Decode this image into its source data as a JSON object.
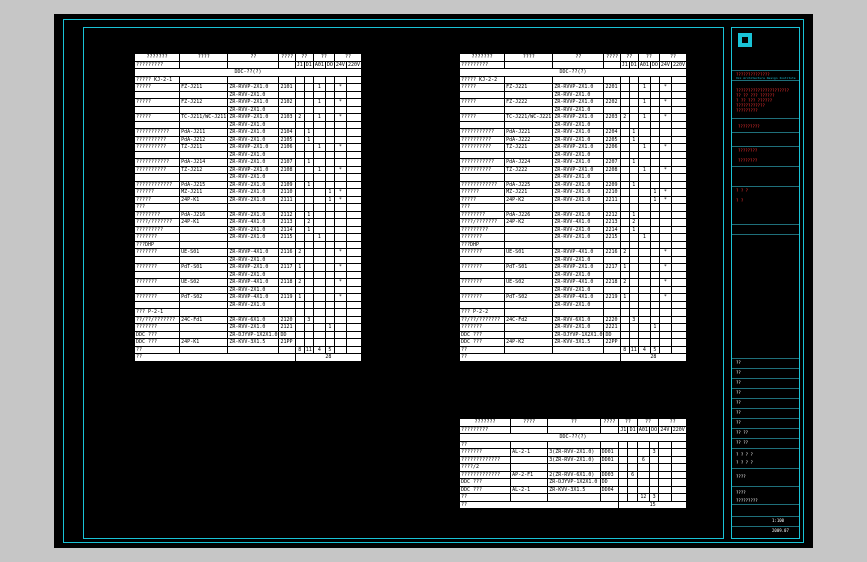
{
  "left_table": {
    "header": [
      "???????",
      "????",
      "??",
      "????",
      "??",
      "??",
      "??"
    ],
    "header2": [
      "?????????",
      "",
      "",
      "",
      "J1",
      "D1",
      "A01",
      "DO",
      "24V",
      "220V"
    ],
    "section": "DDC-??(?)",
    "rows": [
      [
        "????? KJ-2-1",
        "",
        "",
        "",
        "",
        "",
        "",
        "",
        "",
        ""
      ],
      [
        "?????",
        "FZ-J211",
        "ZR-RVVP-2X1.0",
        "2101",
        "",
        "",
        "1",
        "",
        "*",
        ""
      ],
      [
        "",
        "",
        "ZR-RVV-2X1.0",
        "",
        "",
        "",
        "",
        "",
        "",
        ""
      ],
      [
        "?????",
        "FZ-J212",
        "ZR-RVVP-2X1.0",
        "2102",
        "",
        "",
        "1",
        "",
        "*",
        ""
      ],
      [
        "",
        "",
        "ZR-RVV-2X1.0",
        "",
        "",
        "",
        "",
        "",
        "",
        ""
      ],
      [
        "?????",
        "TC-J211/WC-J211",
        "ZR-RVVP-2X1.0",
        "2103",
        "2",
        "",
        "1",
        "",
        "*",
        ""
      ],
      [
        "",
        "",
        "ZR-RVV-2X1.0",
        "",
        "",
        "",
        "",
        "",
        "",
        ""
      ],
      [
        "???????????",
        "PdA-J211",
        "ZR-RVV-2X1.0",
        "2104",
        "",
        "1",
        "",
        "",
        "",
        ""
      ],
      [
        "??????????",
        "PdA-J212",
        "ZR-RVV-2X1.0",
        "2105",
        "",
        "1",
        "",
        "",
        "",
        ""
      ],
      [
        "??????????",
        "TZ-J211",
        "ZR-RVVP-2X1.0",
        "2106",
        "",
        "",
        "1",
        "",
        "*",
        ""
      ],
      [
        "",
        "",
        "ZR-RVV-2X1.0",
        "",
        "",
        "",
        "",
        "",
        "",
        ""
      ],
      [
        "???????????",
        "PdA-J214",
        "ZR-RVV-2X1.0",
        "2107",
        "",
        "1",
        "",
        "",
        "",
        ""
      ],
      [
        "??????????",
        "TZ-J212",
        "ZR-RVVP-2X1.0",
        "2108",
        "",
        "",
        "1",
        "",
        "*",
        ""
      ],
      [
        "",
        "",
        "ZR-RVV-2X1.0",
        "",
        "",
        "",
        "",
        "",
        "",
        ""
      ],
      [
        "????????????",
        "PdA-J215",
        "ZR-RVV-2X1.0",
        "2109",
        "",
        "1",
        "",
        "",
        "",
        ""
      ],
      [
        "??????",
        "MZ-J211",
        "ZR-RVV-2X1.0",
        "2110",
        "",
        "",
        "",
        "1",
        "*",
        ""
      ],
      [
        "?????",
        "24P-K1",
        "ZR-RVV-2X1.0",
        "2111",
        "",
        "",
        "",
        "1",
        "*",
        ""
      ],
      [
        "???",
        "",
        "",
        "",
        "",
        "",
        "",
        "",
        "",
        ""
      ],
      [
        "????????",
        "PdA-J216",
        "ZR-RVV-2X1.0",
        "2112",
        "",
        "1",
        "",
        "",
        "",
        ""
      ],
      [
        "????/???????",
        "24P-K1",
        "ZR-RVV-4X1.0",
        "2113",
        "",
        "2",
        "",
        "",
        "",
        ""
      ],
      [
        "?????????",
        "",
        "ZR-RVV-2X1.0",
        "2114",
        "",
        "1",
        "",
        "",
        "",
        ""
      ],
      [
        "???????",
        "",
        "ZR-RVV-2X1.0",
        "2115",
        "",
        "",
        "1",
        "",
        "",
        ""
      ],
      [
        "???DHP",
        "",
        "",
        "",
        "",
        "",
        "",
        "",
        "",
        ""
      ],
      [
        "???????",
        "UE-S01",
        "ZR-RVVP-4X1.0",
        "2116",
        "2",
        "",
        "",
        "",
        "*",
        ""
      ],
      [
        "",
        "",
        "ZR-RVV-2X1.0",
        "",
        "",
        "",
        "",
        "",
        "",
        ""
      ],
      [
        "???????",
        "PdT-S01",
        "ZR-RVVP-2X1.0",
        "2117",
        "1",
        "",
        "",
        "",
        "*",
        ""
      ],
      [
        "",
        "",
        "ZR-RVV-2X1.0",
        "",
        "",
        "",
        "",
        "",
        "",
        ""
      ],
      [
        "???????",
        "UE-S02",
        "ZR-RVVP-4X1.0",
        "2118",
        "2",
        "",
        "",
        "",
        "*",
        ""
      ],
      [
        "",
        "",
        "ZR-RVV-2X1.0",
        "",
        "",
        "",
        "",
        "",
        "",
        ""
      ],
      [
        "???????",
        "PdT-S02",
        "ZR-RVVP-4X1.0",
        "2119",
        "1",
        "",
        "",
        "",
        "*",
        ""
      ],
      [
        "",
        "",
        "ZR-RVV-2X1.0",
        "",
        "",
        "",
        "",
        "",
        "",
        ""
      ],
      [
        "??? P-2-1",
        "",
        "",
        "",
        "",
        "",
        "",
        "",
        "",
        ""
      ],
      [
        "??/??/???????",
        "24C-Fd1",
        "ZR-RVV-6X1.0",
        "2120",
        "",
        "3",
        "",
        "",
        "",
        ""
      ],
      [
        "???????",
        "",
        "ZR-RVV-2X1.0",
        "2121",
        "",
        "",
        "",
        "1",
        "",
        ""
      ],
      [
        "DDC ???",
        "",
        "ZR-DJYVP-1X2X1.0",
        "DD",
        "",
        "",
        "",
        "",
        "",
        ""
      ],
      [
        "DDC ???",
        "24P-K1",
        "ZR-KVV-3X1.5",
        "21PP",
        "",
        "",
        "",
        "",
        "",
        ""
      ],
      [
        "??",
        "",
        "",
        "",
        "8",
        "11",
        "4",
        "5",
        "",
        ""
      ]
    ],
    "footer_label": "??",
    "footer_total": "28"
  },
  "right_table": {
    "header": [
      "???????",
      "????",
      "??",
      "????",
      "??",
      "??",
      "??"
    ],
    "header2": [
      "?????????",
      "",
      "",
      "",
      "J1",
      "D1",
      "A01",
      "DO",
      "24V",
      "220V"
    ],
    "section": "DDC-??(?)",
    "rows": [
      [
        "????? KJ-2-2",
        "",
        "",
        "",
        "",
        "",
        "",
        "",
        "",
        ""
      ],
      [
        "?????",
        "FZ-J221",
        "ZR-RVVP-2X1.0",
        "2201",
        "",
        "",
        "1",
        "",
        "*",
        ""
      ],
      [
        "",
        "",
        "ZR-RVV-2X1.0",
        "",
        "",
        "",
        "",
        "",
        "",
        ""
      ],
      [
        "?????",
        "FZ-J222",
        "ZR-RVVP-2X1.0",
        "2202",
        "",
        "",
        "1",
        "",
        "*",
        ""
      ],
      [
        "",
        "",
        "ZR-RVV-2X1.0",
        "",
        "",
        "",
        "",
        "",
        "",
        ""
      ],
      [
        "?????",
        "TC-J221/WC-J221",
        "ZR-RVVP-2X1.0",
        "2203",
        "2",
        "",
        "1",
        "",
        "*",
        ""
      ],
      [
        "",
        "",
        "ZR-RVV-2X1.0",
        "",
        "",
        "",
        "",
        "",
        "",
        ""
      ],
      [
        "???????????",
        "PdA-J221",
        "ZR-RVV-2X1.0",
        "2204",
        "",
        "1",
        "",
        "",
        "",
        ""
      ],
      [
        "??????????",
        "PdA-J222",
        "ZR-RVV-2X1.0",
        "2205",
        "",
        "1",
        "",
        "",
        "",
        ""
      ],
      [
        "??????????",
        "TZ-J221",
        "ZR-RVVP-2X1.0",
        "2206",
        "",
        "",
        "1",
        "",
        "*",
        ""
      ],
      [
        "",
        "",
        "ZR-RVV-2X1.0",
        "",
        "",
        "",
        "",
        "",
        "",
        ""
      ],
      [
        "???????????",
        "PdA-J224",
        "ZR-RVV-2X1.0",
        "2207",
        "",
        "1",
        "",
        "",
        "",
        ""
      ],
      [
        "??????????",
        "TZ-J222",
        "ZR-RVVP-2X1.0",
        "2208",
        "",
        "",
        "1",
        "",
        "*",
        ""
      ],
      [
        "",
        "",
        "ZR-RVV-2X1.0",
        "",
        "",
        "",
        "",
        "",
        "",
        ""
      ],
      [
        "????????????",
        "PdA-J225",
        "ZR-RVV-2X1.0",
        "2209",
        "",
        "1",
        "",
        "",
        "",
        ""
      ],
      [
        "??????",
        "MZ-J221",
        "ZR-RVV-2X1.0",
        "2210",
        "",
        "",
        "",
        "1",
        "*",
        ""
      ],
      [
        "?????",
        "24P-K2",
        "ZR-RVV-2X1.0",
        "2211",
        "",
        "",
        "",
        "1",
        "*",
        ""
      ],
      [
        "???",
        "",
        "",
        "",
        "",
        "",
        "",
        "",
        "",
        ""
      ],
      [
        "????????",
        "PdA-J226",
        "ZR-RVV-2X1.0",
        "2212",
        "",
        "1",
        "",
        "",
        "",
        ""
      ],
      [
        "????/???????",
        "24P-K2",
        "ZR-RVV-4X1.0",
        "2213",
        "",
        "2",
        "",
        "",
        "",
        ""
      ],
      [
        "?????????",
        "",
        "ZR-RVV-2X1.0",
        "2214",
        "",
        "1",
        "",
        "",
        "",
        ""
      ],
      [
        "???????",
        "",
        "ZR-RVV-2X1.0",
        "2215",
        "",
        "",
        "1",
        "",
        "",
        ""
      ],
      [
        "???DHP",
        "",
        "",
        "",
        "",
        "",
        "",
        "",
        "",
        ""
      ],
      [
        "???????",
        "UE-S01",
        "ZR-RVVP-4X1.0",
        "2216",
        "2",
        "",
        "",
        "",
        "*",
        ""
      ],
      [
        "",
        "",
        "ZR-RVV-2X1.0",
        "",
        "",
        "",
        "",
        "",
        "",
        ""
      ],
      [
        "???????",
        "PdT-S01",
        "ZR-RVVP-2X1.0",
        "2217",
        "1",
        "",
        "",
        "",
        "*",
        ""
      ],
      [
        "",
        "",
        "ZR-RVV-2X1.0",
        "",
        "",
        "",
        "",
        "",
        "",
        ""
      ],
      [
        "???????",
        "UE-S02",
        "ZR-RVVP-4X1.0",
        "2218",
        "2",
        "",
        "",
        "",
        "*",
        ""
      ],
      [
        "",
        "",
        "ZR-RVV-2X1.0",
        "",
        "",
        "",
        "",
        "",
        "",
        ""
      ],
      [
        "???????",
        "PdT-S02",
        "ZR-RVVP-4X1.0",
        "2219",
        "1",
        "",
        "",
        "",
        "*",
        ""
      ],
      [
        "",
        "",
        "ZR-RVV-2X1.0",
        "",
        "",
        "",
        "",
        "",
        "",
        ""
      ],
      [
        "??? P-2-2",
        "",
        "",
        "",
        "",
        "",
        "",
        "",
        "",
        ""
      ],
      [
        "??/??/???????",
        "24C-Fd2",
        "ZR-RVV-6X1.0",
        "2220",
        "",
        "3",
        "",
        "",
        "",
        ""
      ],
      [
        "???????",
        "",
        "ZR-RVV-2X1.0",
        "2221",
        "",
        "",
        "",
        "1",
        "",
        ""
      ],
      [
        "DDC ???",
        "",
        "ZR-DJYVP-1X2X1.0",
        "DD",
        "",
        "",
        "",
        "",
        "",
        ""
      ],
      [
        "DDC ???",
        "24P-K2",
        "ZR-KVV-3X1.5",
        "22PP",
        "",
        "",
        "",
        "",
        "",
        ""
      ],
      [
        "??",
        "",
        "",
        "",
        "8",
        "11",
        "4",
        "5",
        "",
        ""
      ]
    ],
    "footer_label": "??",
    "footer_total": "28"
  },
  "small_table": {
    "header": [
      "???????",
      "????",
      "??",
      "????",
      "??",
      "??",
      "??"
    ],
    "header2": [
      "?????????",
      "",
      "",
      "",
      "J1",
      "D1",
      "A01",
      "DO",
      "24V",
      "220V"
    ],
    "section": "DDC-??(?)",
    "rows": [
      [
        "??",
        "",
        "",
        "",
        "",
        "",
        "",
        "",
        "",
        ""
      ],
      [
        "???????",
        "AL-2-1",
        "3(ZR-RVV-2X1.0)",
        "DD01",
        "",
        "",
        "",
        "3",
        "",
        ""
      ],
      [
        "?????????????",
        "",
        "3(ZR-RVV-2X1.0)",
        "DD01",
        "",
        "",
        "6",
        "",
        "",
        ""
      ],
      [
        "????/2",
        "",
        "",
        "",
        "",
        "",
        "",
        "",
        "",
        ""
      ],
      [
        "?????????????",
        "AP-2-F1",
        "2(ZR-RVV-6X1.0)",
        "DD03",
        "",
        "6",
        "",
        "",
        "",
        ""
      ],
      [
        "DDC ???",
        "",
        "ZR-DJYVP-1X2X1.0",
        "DD",
        "",
        "",
        "",
        "",
        "",
        ""
      ],
      [
        "DDC ???",
        "AL-2-1",
        "ZR-KVV-3X1.5",
        "DD04",
        "",
        "",
        "",
        "",
        "",
        ""
      ],
      [
        "??",
        "",
        "",
        "",
        "",
        "",
        "12",
        "3",
        "",
        ""
      ]
    ],
    "footer_label": "??",
    "footer_total": "15"
  },
  "title_block": {
    "company": "??????????????",
    "company_en": "Xxx Architecture Design Institute",
    "note_lines": [
      "??????????????????????",
      "?? ?? ??? ??????",
      "? ?? ??? ??????",
      "????????????",
      "?????????"
    ],
    "project_label": "?????????",
    "sheet_label": "????????",
    "drawing_no_label": "????????",
    "rev_label": "? ? ?",
    "rev_value": "? ?",
    "footer_rows": [
      "??",
      "??",
      "??",
      "??",
      "??",
      "??",
      "??"
    ],
    "small_labels": [
      "?? ??",
      "?? ??",
      "? ? ? ?",
      "? ? ? ?"
    ],
    "bottom_labels": [
      "????",
      "????",
      "?????????"
    ],
    "date_value": "2009.07",
    "scale_value": "1:100"
  },
  "colors": {
    "paper": "#000000",
    "frame": "#19c3d6",
    "background": "#c6c6c6",
    "table_bg": "#ffffff",
    "title_text": "#ff3333"
  }
}
